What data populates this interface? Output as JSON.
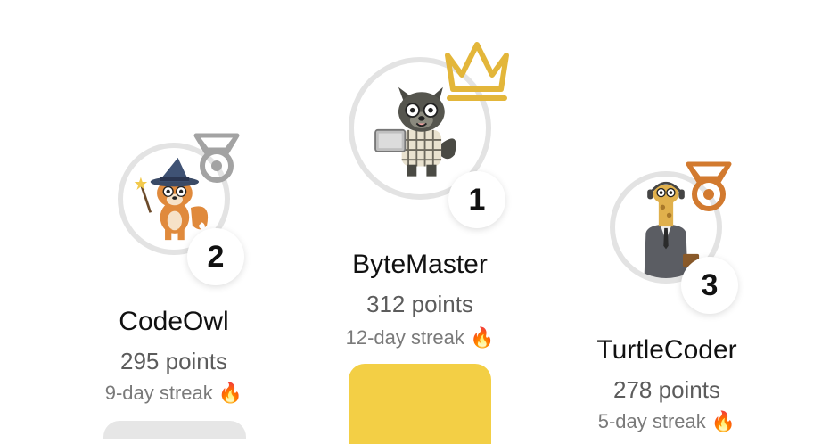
{
  "leaderboard": {
    "entries": [
      {
        "rank": "2",
        "name": "CodeOwl",
        "points": "295 points",
        "streak": "9-day streak 🔥",
        "avatar": "wizard-fox-avatar",
        "trophy": "silver-medal-icon",
        "trophy_color": "#a3a3a3",
        "podium_color": "#e6e6e6"
      },
      {
        "rank": "1",
        "name": "ByteMaster",
        "points": "312 points",
        "streak": "12-day streak 🔥",
        "avatar": "wolf-laptop-avatar",
        "trophy": "crown-icon",
        "trophy_color": "#e3b63a",
        "podium_color": "#f3cf45"
      },
      {
        "rank": "3",
        "name": "TurtleCoder",
        "points": "278 points",
        "streak": "5-day streak 🔥",
        "avatar": "giraffe-suit-avatar",
        "trophy": "bronze-medal-icon",
        "trophy_color": "#d27a2f",
        "podium_color": "#e6e6e6"
      }
    ]
  }
}
